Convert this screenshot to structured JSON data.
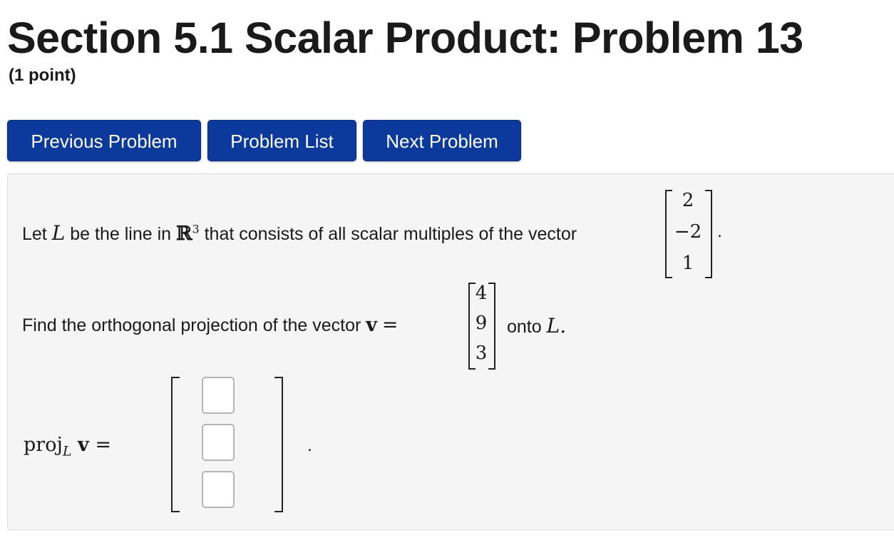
{
  "header": {
    "title": "Section 5.1 Scalar Product: Problem 13",
    "points": "(1 point)"
  },
  "nav": {
    "previous": "Previous Problem",
    "list": "Problem List",
    "next": "Next Problem"
  },
  "problem": {
    "line1_prefix": "Let",
    "line1_var": "L",
    "line1_middle": "be the line in",
    "line1_space": "ℝ",
    "line1_exp": "3",
    "line1_suffix": "that consists of all scalar multiples of the vector",
    "vector_u": [
      "2",
      "−2",
      "1"
    ],
    "period": ".",
    "line2_prefix": "Find the orthogonal projection of the vector",
    "line2_var": "v",
    "line2_equals": "=",
    "vector_v": [
      "4",
      "9",
      "3"
    ],
    "line2_suffix": "onto",
    "line2_target": "L.",
    "answer_label": "proj",
    "answer_sub": "L",
    "answer_var": "v",
    "answer_equals": "=",
    "answer_values": [
      "",
      "",
      ""
    ],
    "answer_period": "."
  }
}
